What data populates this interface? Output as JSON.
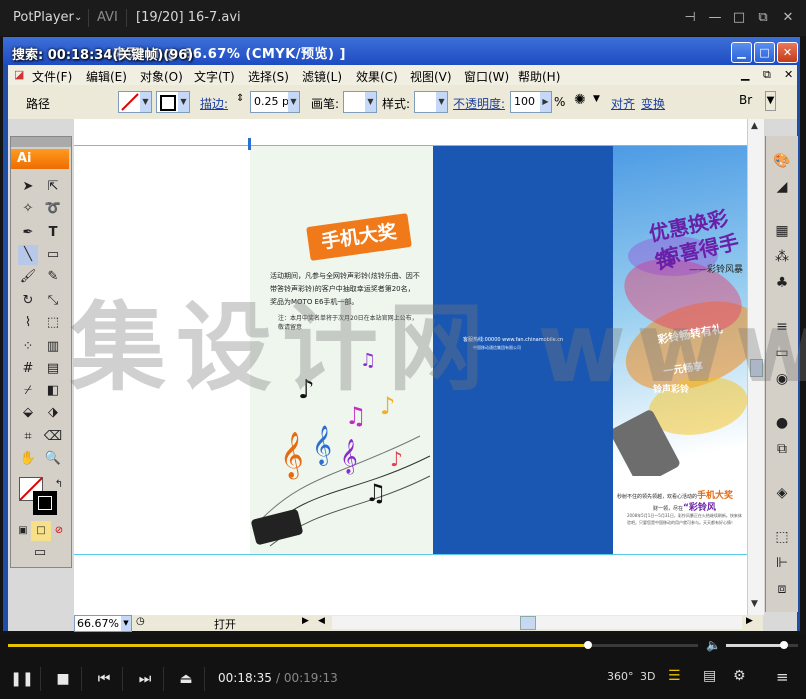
{
  "player": {
    "app_name": "PotPlayer",
    "format": "AVI",
    "file_title": "[19/20] 16-7.avi",
    "current_time": "00:18:35",
    "total_time": "/ 00:19:13",
    "progress_fraction": 0.84,
    "volume_fraction": 0.8,
    "btn_360": "360°",
    "btn_3d": "3D"
  },
  "illustrator": {
    "window_title": "来页.ai @ 66.67% (CMYK/预览) ]",
    "search_overlay": "搜索: 00:18:34(关键帧)(96)",
    "menu": [
      "文件(F)",
      "编辑(E)",
      "对象(O)",
      "文字(T)",
      "选择(S)",
      "滤镜(L)",
      "效果(C)",
      "视图(V)",
      "窗口(W)",
      "帮助(H)"
    ],
    "control_bar": {
      "label_path": "路径",
      "label_stroke": "描边:",
      "stroke_value": "0.25 p",
      "label_brush": "画笔:",
      "label_style": "样式:",
      "label_opacity": "不透明度:",
      "opacity_value": "100",
      "percent": "%",
      "label_align": "对齐",
      "label_transform": "变换"
    },
    "ai_logo": "Ai",
    "zoom_value": "66.67%",
    "status_text": "打开",
    "doc": {
      "title_badge": "手机大奖",
      "body_text": "活动期间，凡参与全网铃声彩铃(炫铃乐曲、因不带答铃声彩铃)的客户中抽取幸运奖者第20名，奖品为MOTO E6手机一部。",
      "note_text": "注：本月中奖名单将于次月20日在本站官网上公布，敬请留意",
      "hotline": "客服热线:00000  www.fan.chinamobile.cn",
      "company": "中国移动通信集团有限公司",
      "headline1": "优惠换彩铃",
      "headline2": "惊喜得手",
      "slogan": "——彩铃风暴",
      "swirl1": "彩铃畅转有礼",
      "swirl2": "一元畅享",
      "swirl3": "铃声彩铃",
      "bottom_prefix": "秒射不住的领先领越，欢看心活动的",
      "bottom_highlight": "手机大奖",
      "bottom_line2": "财一领，尽在",
      "bottom_highlight2": "“彩铃风",
      "bottom_para": "2008年5月1日～5月31日，彩铃风暴正在火热继续刷新。快来体验吧。只要您是中国移动的用户就可参与。天天都有好心情！"
    },
    "watermark": "集设计网 www.jisheji.com"
  },
  "colors": {
    "xp_title_blue": "#1d4cc2",
    "player_accent": "#e8c200",
    "doc_blue": "#1957b3",
    "badge_orange": "#f07a1a"
  }
}
